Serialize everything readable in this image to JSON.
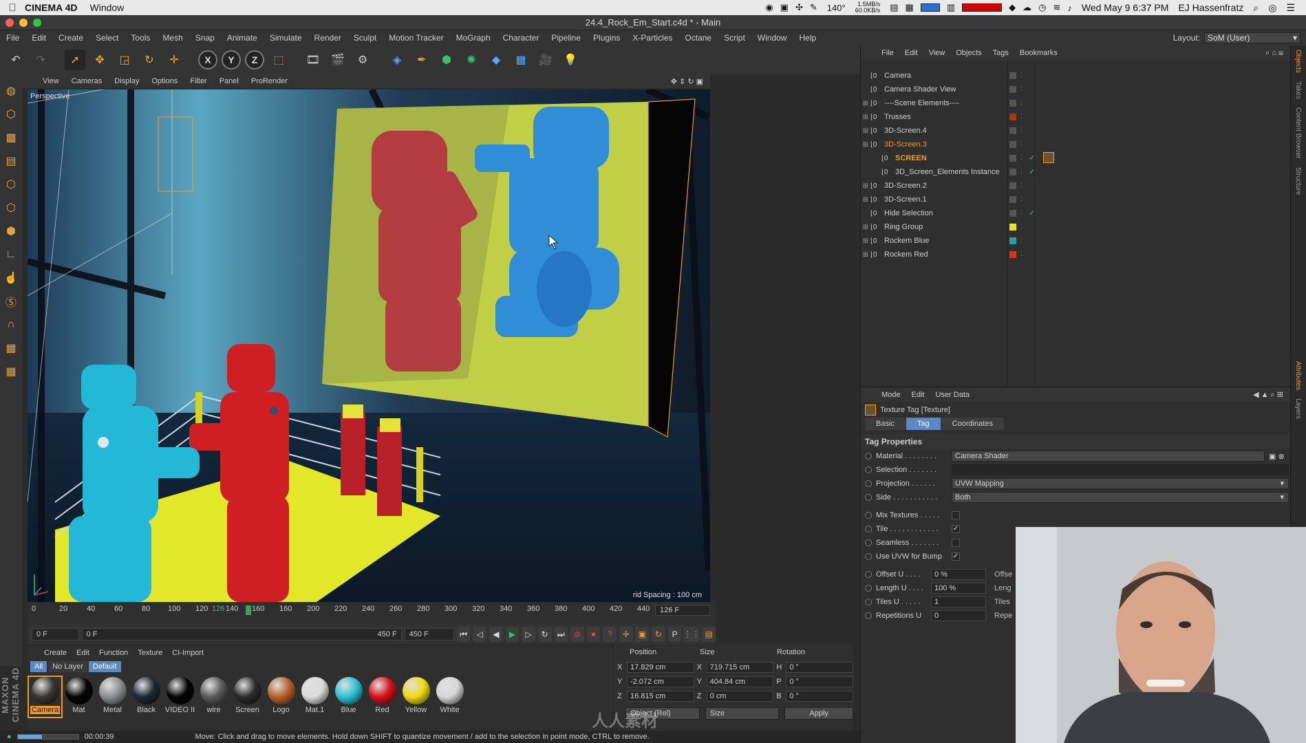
{
  "mac_menubar": {
    "app_name": "CINEMA 4D",
    "menu_window": "Window",
    "temperature": "140°",
    "net_up": "1.5MB/s",
    "net_down": "60.0KB/s",
    "datetime": "Wed May 9  6:37 PM",
    "user": "EJ Hassenfratz"
  },
  "title": "24.4_Rock_Em_Start.c4d * - Main",
  "menu": [
    "File",
    "Edit",
    "Create",
    "Select",
    "Tools",
    "Mesh",
    "Snap",
    "Animate",
    "Simulate",
    "Render",
    "Sculpt",
    "Motion Tracker",
    "MoGraph",
    "Character",
    "Pipeline",
    "Plugins",
    "X-Particles",
    "Octane",
    "Script",
    "Window",
    "Help"
  ],
  "layout": {
    "label": "Layout:",
    "value": "SoM (User)"
  },
  "viewport": {
    "menu": [
      "View",
      "Cameras",
      "Display",
      "Options",
      "Filter",
      "Panel",
      "ProRender"
    ],
    "label": "Perspective",
    "grid_spacing": "rid Spacing : 100 cm"
  },
  "timeline": {
    "ticks": [
      "0",
      "20",
      "40",
      "60",
      "80",
      "100",
      "120",
      "126",
      "140",
      "160",
      "160",
      "200",
      "220",
      "240",
      "260",
      "280",
      "300",
      "320",
      "340",
      "360",
      "380",
      "400",
      "420",
      "440"
    ],
    "current_frame": "126 F"
  },
  "transport": {
    "start": "0 F",
    "range_start": "0 F",
    "range_end": "450 F",
    "end": "450 F"
  },
  "materials": {
    "menu": [
      "Create",
      "Edit",
      "Function",
      "Texture",
      "CI-Import"
    ],
    "filters": [
      "All",
      "No Layer",
      "Default"
    ],
    "items": [
      {
        "name": "Camera",
        "color": "#3b3630"
      },
      {
        "name": "Mat",
        "color": "#050505"
      },
      {
        "name": "Metal",
        "color": "#8b8f94"
      },
      {
        "name": "Black",
        "color": "#1d2933"
      },
      {
        "name": "VIDEO II",
        "color": "#050505"
      },
      {
        "name": "wire",
        "color": "#5b5b5b"
      },
      {
        "name": "Screen",
        "color": "#2c2c2c"
      },
      {
        "name": "Logo",
        "color": "#b7622a"
      },
      {
        "name": "Mat.1",
        "color": "#dcdcdc"
      },
      {
        "name": "Blue",
        "color": "#2cc3d6"
      },
      {
        "name": "Red",
        "color": "#d9121b"
      },
      {
        "name": "Yellow",
        "color": "#f1da16"
      },
      {
        "name": "White",
        "color": "#d6d6d6"
      }
    ]
  },
  "coordinates": {
    "headers": [
      "Position",
      "Size",
      "Rotation"
    ],
    "rows": [
      {
        "axis": "X",
        "pos": "17.829 cm",
        "size_axis": "X",
        "size": "719.715 cm",
        "rot_axis": "H",
        "rot": "0 °"
      },
      {
        "axis": "Y",
        "pos": "-2.072 cm",
        "size_axis": "Y",
        "size": "404.84 cm",
        "rot_axis": "P",
        "rot": "0 °"
      },
      {
        "axis": "Z",
        "pos": "16.815 cm",
        "size_axis": "Z",
        "size": "0 cm",
        "rot_axis": "B",
        "rot": "0 °"
      }
    ],
    "mode": "Object (Rel)",
    "size_mode": "Size",
    "apply": "Apply"
  },
  "status": {
    "progress": 0.4,
    "time": "00:00:39",
    "message": "Move: Click and drag to move elements. Hold down SHIFT to quantize movement / add to the selection in point mode, CTRL to remove."
  },
  "brand": "MAXON CINEMA 4D",
  "objects": {
    "menu": [
      "File",
      "Edit",
      "View",
      "Objects",
      "Tags",
      "Bookmarks"
    ],
    "items": [
      {
        "name": "Camera",
        "selected": false,
        "layer": "",
        "check": false,
        "tag": false
      },
      {
        "name": "Camera Shader View",
        "selected": false,
        "layer": "",
        "check": false,
        "tag": false
      },
      {
        "name": "----Scene Elements----",
        "selected": false,
        "layer": "",
        "check": false,
        "tag": false
      },
      {
        "name": "Trusses",
        "selected": false,
        "layer": "#a33a12",
        "check": false,
        "tag": false
      },
      {
        "name": "3D-Screen.4",
        "selected": false,
        "layer": "",
        "check": false,
        "tag": false
      },
      {
        "name": "3D-Screen.3",
        "selected": true,
        "layer": "",
        "check": false,
        "tag": false
      },
      {
        "name": "SCREEN",
        "selected": true,
        "layer": "",
        "check": true,
        "tag": true
      },
      {
        "name": "3D_Screen_Elements Instance",
        "selected": false,
        "layer": "",
        "check": true,
        "tag": false
      },
      {
        "name": "3D-Screen.2",
        "selected": false,
        "layer": "",
        "check": false,
        "tag": false
      },
      {
        "name": "3D-Screen.1",
        "selected": false,
        "layer": "",
        "check": false,
        "tag": false
      },
      {
        "name": "Hide Selection",
        "selected": false,
        "layer": "",
        "check": true,
        "tag": false
      },
      {
        "name": "Ring Group",
        "selected": false,
        "layer": "#e6e61a",
        "check": false,
        "tag": false
      },
      {
        "name": "Rockem Blue",
        "selected": false,
        "layer": "#2aa1a8",
        "check": false,
        "tag": false
      },
      {
        "name": "Rockem Red",
        "selected": false,
        "layer": "#d9331a",
        "check": false,
        "tag": false
      }
    ]
  },
  "attributes": {
    "menu": [
      "Mode",
      "Edit",
      "User Data"
    ],
    "title": "Texture Tag [Texture]",
    "tabs": [
      "Basic",
      "Tag",
      "Coordinates"
    ],
    "section": "Tag Properties",
    "material": {
      "label": "Material . . . . . . . .",
      "value": "Camera Shader"
    },
    "selection": {
      "label": "Selection . . . . . . .",
      "value": ""
    },
    "projection": {
      "label": "Projection . . . . . .",
      "value": "UVW Mapping"
    },
    "side": {
      "label": "Side . . . . . . . . . . .",
      "value": "Both"
    },
    "checks": [
      {
        "label": "Mix Textures . . . . .",
        "checked": ""
      },
      {
        "label": "Tile . . . . . . . . . . . .",
        "checked": "✓"
      },
      {
        "label": "Seamless . . . . . . .",
        "checked": ""
      },
      {
        "label": "Use UVW for Bump",
        "checked": "✓"
      }
    ],
    "numbers": [
      {
        "label": "Offset U . . . .",
        "value": "0 %",
        "rest": "Offse"
      },
      {
        "label": "Length U . . . .",
        "value": "100 %",
        "rest": "Leng"
      },
      {
        "label": "Tiles U . . . . .",
        "value": "1",
        "rest": "Tiles"
      },
      {
        "label": "Repetitions U",
        "value": "0",
        "rest": "Repe"
      }
    ]
  },
  "right_tabs": [
    "Objects",
    "Takes",
    "Content Browser",
    "Structure",
    "Attributes",
    "Layers"
  ],
  "watermark": "人人素材"
}
